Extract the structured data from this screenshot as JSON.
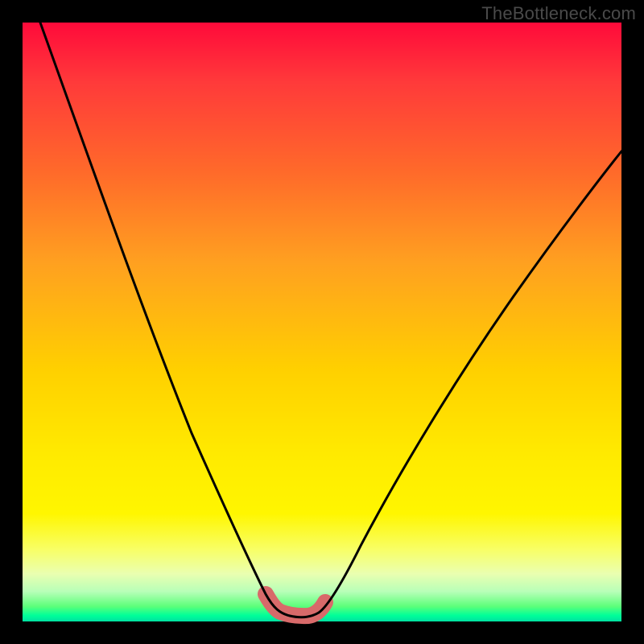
{
  "watermark": "TheBottleneck.com",
  "chart_data": {
    "type": "line",
    "title": "",
    "xlabel": "",
    "ylabel": "",
    "xlim": [
      0,
      100
    ],
    "ylim": [
      0,
      100
    ],
    "grid": false,
    "legend": false,
    "series": [
      {
        "name": "bottleneck-curve",
        "x": [
          3,
          10,
          18,
          25,
          30,
          34,
          37,
          40,
          41.5,
          43,
          45,
          47,
          49,
          53,
          58,
          65,
          75,
          85,
          95,
          100
        ],
        "y": [
          100,
          80,
          60,
          42,
          28,
          17,
          10,
          4,
          2,
          1,
          1,
          1,
          2,
          5,
          12,
          23,
          38,
          52,
          62,
          66
        ]
      },
      {
        "name": "bottleneck-band",
        "x": [
          41,
          42,
          43,
          44,
          45,
          46,
          47,
          48,
          49
        ],
        "y": [
          3,
          1.5,
          1,
          0.8,
          0.8,
          0.9,
          1,
          1.6,
          3
        ]
      }
    ],
    "colors": {
      "curve": "#000000",
      "band": "#d86a6a",
      "gradient_top": "#ff0a3a",
      "gradient_bottom": "#00e0a0"
    }
  }
}
